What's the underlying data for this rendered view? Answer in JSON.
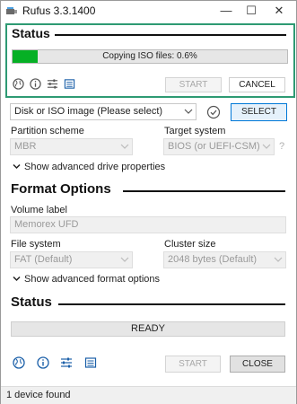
{
  "window": {
    "title": "Rufus 3.3.1400",
    "minimize": "—",
    "maximize": "☐",
    "close": "✕"
  },
  "overlay": {
    "title": "Status",
    "progress": {
      "text": "Copying ISO files: 0.6%",
      "fraction": 0.09,
      "color": "#06b025"
    },
    "start_label": "START",
    "cancel_label": "CANCEL"
  },
  "drive": {
    "boot_selection_value": "Disk or ISO image (Please select)",
    "select_label": "SELECT",
    "partition_scheme_label": "Partition scheme",
    "partition_scheme_value": "MBR",
    "target_system_label": "Target system",
    "target_system_value": "BIOS (or UEFI-CSM)",
    "help_glyph": "?",
    "advanced_drive_label": "Show advanced drive properties"
  },
  "format": {
    "title": "Format Options",
    "volume_label_label": "Volume label",
    "volume_label_value": "Memorex UFD",
    "file_system_label": "File system",
    "file_system_value": "FAT (Default)",
    "cluster_size_label": "Cluster size",
    "cluster_size_value": "2048 bytes (Default)",
    "advanced_format_label": "Show advanced format options"
  },
  "status": {
    "title": "Status",
    "ready_text": "READY",
    "start_label": "START",
    "close_label": "CLOSE"
  },
  "statusbar": {
    "text": "1 device found"
  },
  "colors": {
    "accent_border": "#2e9a73",
    "progress_green": "#06b025",
    "select_border": "#0078d7"
  }
}
